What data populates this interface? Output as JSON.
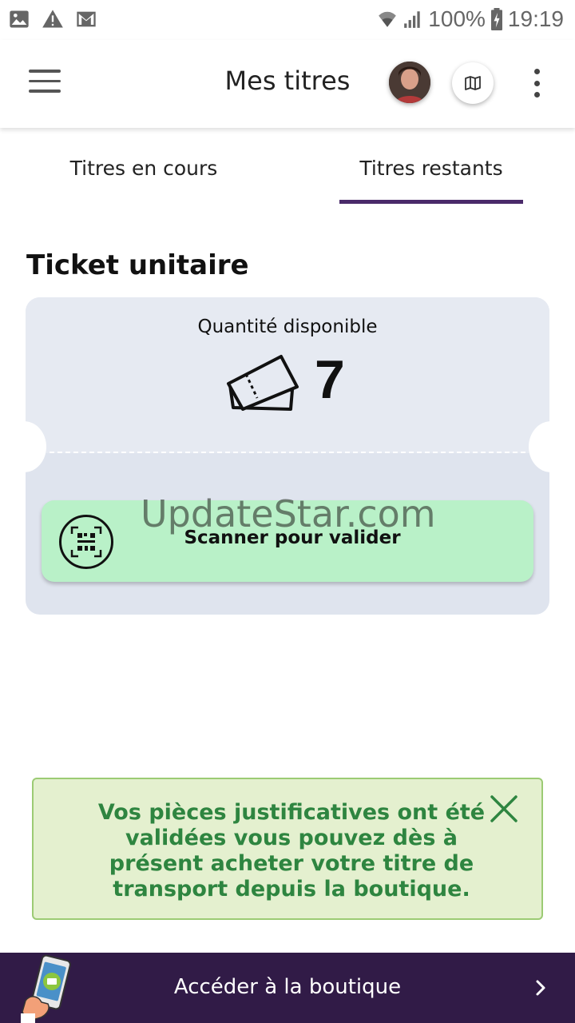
{
  "status_bar": {
    "battery": "100%",
    "time": "19:19",
    "icons": [
      "image-icon",
      "warning-icon",
      "gmail-icon",
      "wifi-icon",
      "signal-icon",
      "battery-charging-icon"
    ]
  },
  "app_bar": {
    "title": "Mes titres",
    "icons": [
      "menu-icon",
      "avatar",
      "map-icon",
      "more-vert-icon"
    ]
  },
  "tabs": [
    {
      "label": "Titres en cours",
      "selected": false
    },
    {
      "label": "Titres restants",
      "selected": true
    }
  ],
  "section": {
    "title": "Ticket unitaire"
  },
  "ticket": {
    "quantity_label": "Quantité disponible",
    "quantity": "7",
    "icon": "tickets-icon",
    "scan_button_label": "Scanner pour valider",
    "scan_icon": "qr-scan-icon"
  },
  "watermark": "UpdateStar.com",
  "notice": {
    "text": "Vos pièces justificatives ont été validées vous pouvez dès à présent acheter votre titre de transport depuis la boutique.",
    "close_icon": "close-icon"
  },
  "bottom_bar": {
    "label": "Accéder à la boutique",
    "icon": "chevron-right-icon"
  },
  "colors": {
    "tab_indicator": "#4a2a6a",
    "ticket_background": "#e6eaf2",
    "scan_button": "#b9f1c8",
    "notice_background": "#e4f0cf",
    "notice_text": "#2e8540",
    "bottom_bar": "#311b47"
  }
}
